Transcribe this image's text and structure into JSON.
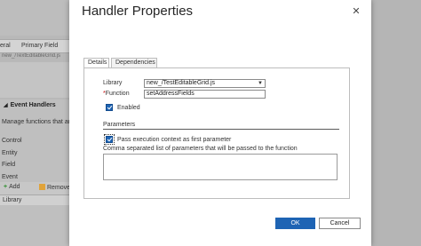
{
  "background": {
    "grid_columns": [
      "eral",
      "Primary Field"
    ],
    "grid_cell": "new_/TextEditableGrid.js",
    "event_handlers": {
      "title": "Event Handlers",
      "description": "Manage functions that ar",
      "items": [
        "Control",
        "Entity",
        "Field",
        "Event"
      ],
      "add_label": "Add",
      "remove_label": "Remove",
      "library_header": "Library"
    }
  },
  "dialog": {
    "title": "Handler Properties",
    "tabs": [
      {
        "label": "Details",
        "active": true
      },
      {
        "label": "Dependencies",
        "active": false
      }
    ],
    "details": {
      "library_label": "Library",
      "library_value": "new_/TestEditableGrid.js",
      "function_required_marker": "*",
      "function_label": "Function",
      "function_value": "setAddressFields",
      "enabled_label": "Enabled",
      "enabled_checked": true,
      "parameters_heading": "Parameters",
      "pass_context_label": "Pass execution context as first parameter",
      "pass_context_checked": true,
      "params_description": "Comma separated list of parameters that will be passed to the function",
      "params_value": ""
    },
    "buttons": {
      "ok_label": "OK",
      "cancel_label": "Cancel"
    }
  },
  "colors": {
    "primary_button": "#1e64b4",
    "required_marker": "#c00000",
    "add_icon": "#2f8f2f"
  }
}
